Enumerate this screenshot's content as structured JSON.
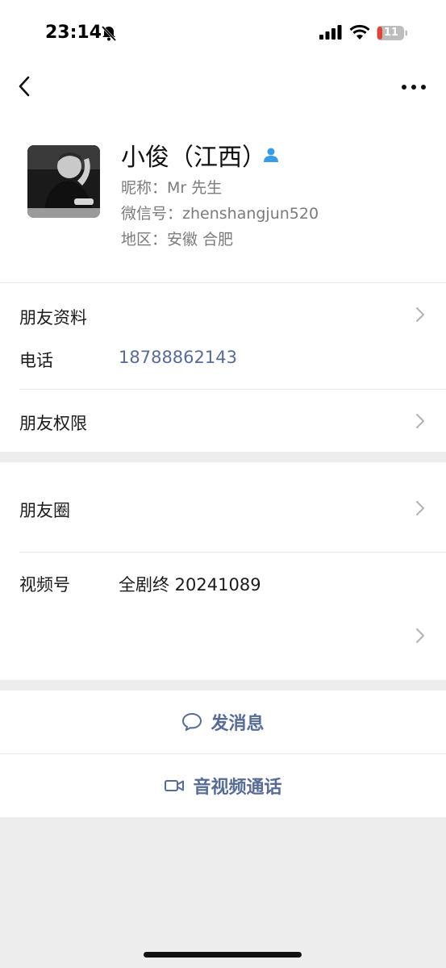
{
  "status_bar": {
    "time": "23:14",
    "battery": "11",
    "icons": [
      "bell-slash-icon",
      "signal-icon",
      "wifi-icon",
      "battery-icon"
    ]
  },
  "nav": {
    "icons": [
      "back-chevron-icon",
      "more-dots-icon"
    ]
  },
  "profile": {
    "name": "小俊（江西）",
    "nickname": "昵称：Mr 先生",
    "wechat_id": "微信号：zhenshangjun520",
    "region": "地区：安徽 合肥",
    "icons": [
      "avatar",
      "verified-person-icon"
    ]
  },
  "rows": {
    "friend_profile": "朋友资料",
    "phone_label": "电话",
    "phone_value": "18788862143",
    "friend_permissions": "朋友权限",
    "moments": "朋友圈",
    "channels_label": "视频号",
    "channels_value": "全剧终 20241089"
  },
  "actions": {
    "send_message": "发消息",
    "video_call": "音视频通话",
    "icons": [
      "chat-bubble-icon",
      "video-camera-icon"
    ]
  },
  "colors": {
    "link_blue": "#576b95",
    "background": "#ededed",
    "verified_blue": "#3a9be6"
  }
}
